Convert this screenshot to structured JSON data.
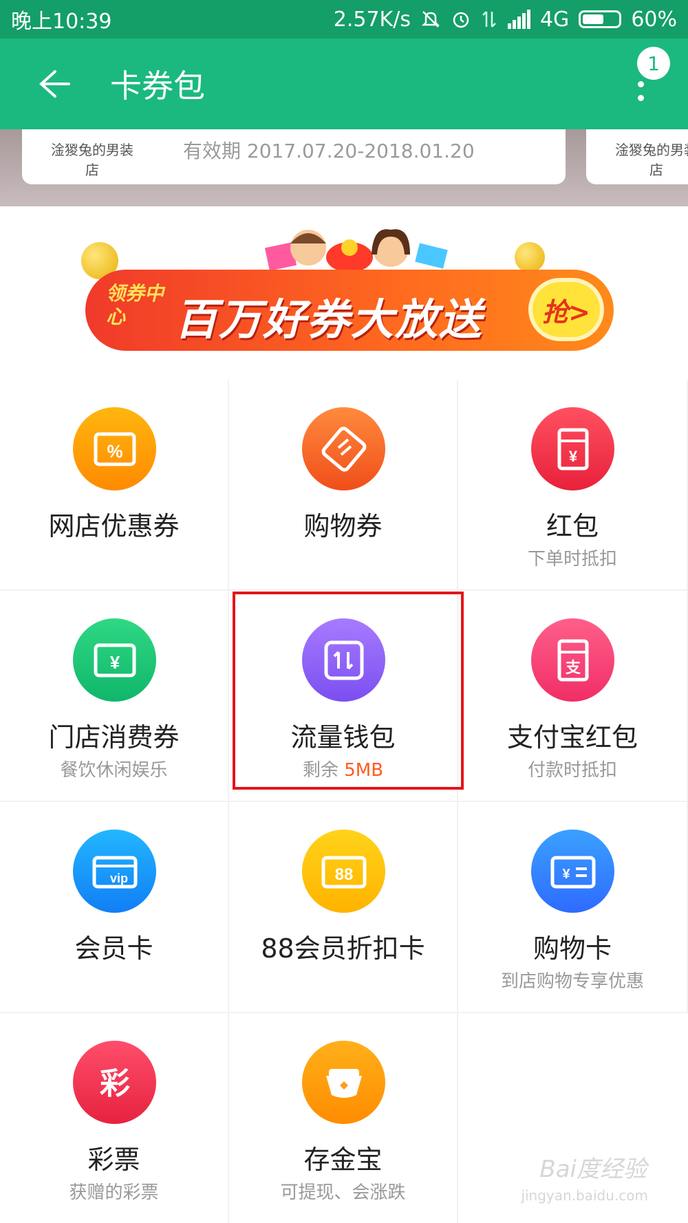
{
  "status_bar": {
    "time": "晚上10:39",
    "speed": "2.57K/s",
    "network": "4G",
    "battery": "60%",
    "battery_level": 0.6
  },
  "app_bar": {
    "title": "卡券包",
    "badge_count": "1"
  },
  "card_strip": {
    "card_logo": "淦猣兔的男装店",
    "card_valid": "有效期 2017.07.20-2018.01.20"
  },
  "banner": {
    "small_text": "领券中心",
    "big_text": "百万好券大放送",
    "button_text": "抢>"
  },
  "grid": [
    {
      "label": "网店优惠券",
      "sub": "",
      "icon": "coupon-percent-icon",
      "color": [
        "#ffb60f",
        "#ff8a00"
      ]
    },
    {
      "label": "购物券",
      "sub": "",
      "icon": "shopping-voucher-icon",
      "color": [
        "#ff8a3d",
        "#f04e1a"
      ]
    },
    {
      "label": "红包",
      "sub": "下单时抵扣",
      "icon": "red-envelope-icon",
      "color": [
        "#ff5060",
        "#e8213a"
      ]
    },
    {
      "label": "门店消费券",
      "sub": "餐饮休闲娱乐",
      "icon": "store-voucher-icon",
      "color": [
        "#2fd884",
        "#10b66a"
      ]
    },
    {
      "label": "流量钱包",
      "sub_prefix": "剩余 ",
      "sub_value": "5MB",
      "icon": "data-wallet-icon",
      "color": [
        "#a77bff",
        "#7a4ff0"
      ]
    },
    {
      "label": "支付宝红包",
      "sub": "付款时抵扣",
      "icon": "alipay-red-envelope-icon",
      "color": [
        "#ff5f8a",
        "#f02e66"
      ]
    },
    {
      "label": "会员卡",
      "sub": "",
      "icon": "vip-card-icon",
      "color": [
        "#23b6ff",
        "#117ef5"
      ]
    },
    {
      "label": "88会员折扣卡",
      "sub": "",
      "icon": "discount-card-88-icon",
      "color": [
        "#ffd31a",
        "#ffb300"
      ]
    },
    {
      "label": "购物卡",
      "sub": "到店购物专享优惠",
      "icon": "shopping-card-icon",
      "color": [
        "#3aa0ff",
        "#2f6bff"
      ]
    },
    {
      "label": "彩票",
      "sub": "获赠的彩票",
      "icon": "lottery-icon",
      "color": [
        "#ff4d6b",
        "#e6233f"
      ]
    },
    {
      "label": "存金宝",
      "sub": "可提现、会涨跌",
      "icon": "gold-ingot-icon",
      "color": [
        "#ffb01a",
        "#ff8c00"
      ]
    }
  ],
  "watermark": {
    "main": "Bai度经验",
    "url": "jingyan.baidu.com"
  }
}
